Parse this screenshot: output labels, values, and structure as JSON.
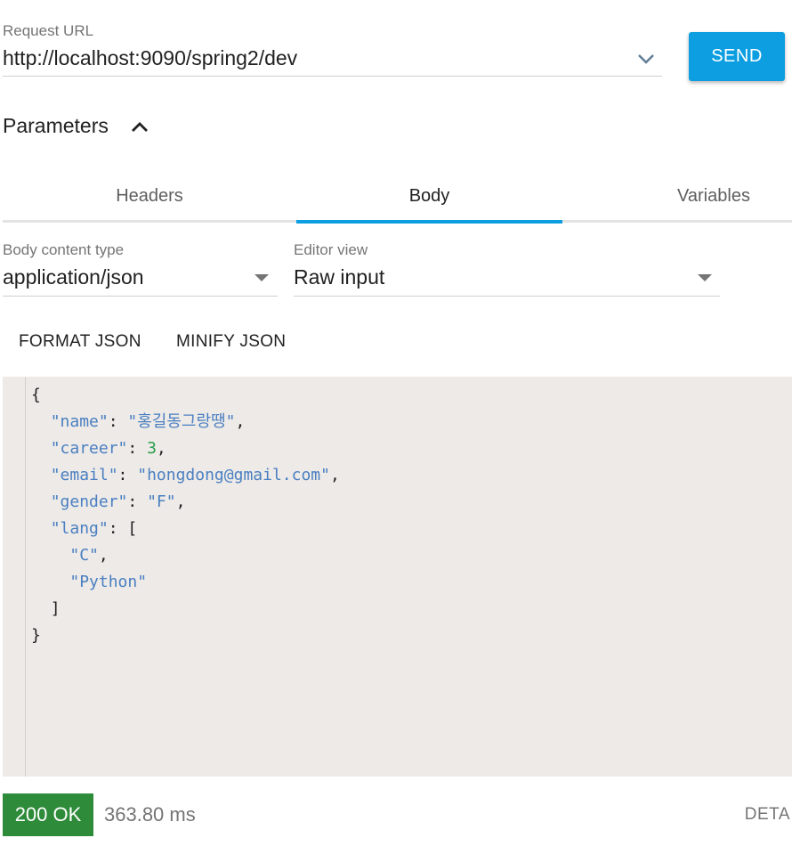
{
  "request": {
    "url_label": "Request URL",
    "url_value": "http://localhost:9090/spring2/dev",
    "send_label": "SEND"
  },
  "parameters": {
    "title": "Parameters",
    "tabs": [
      {
        "label": "Headers"
      },
      {
        "label": "Body",
        "active": true
      },
      {
        "label": "Variables"
      }
    ]
  },
  "body": {
    "content_type_label": "Body content type",
    "content_type_value": "application/json",
    "editor_view_label": "Editor view",
    "editor_view_value": "Raw input",
    "format_label": "FORMAT JSON",
    "minify_label": "MINIFY JSON",
    "code": {
      "open_brace": "{",
      "name_key": "\"name\"",
      "name_val": "\"홍길동그랑땡\"",
      "career_key": "\"career\"",
      "career_val": "3",
      "email_key": "\"email\"",
      "email_val": "\"hongdong@gmail.com\"",
      "gender_key": "\"gender\"",
      "gender_val": "\"F\"",
      "lang_key": "\"lang\"",
      "lang_open": "[",
      "lang_item1": "\"C\"",
      "lang_item2": "\"Python\"",
      "lang_close": "]",
      "close_brace": "}"
    }
  },
  "response": {
    "status": "200 OK",
    "time": "363.80 ms",
    "details_label": "DETA"
  },
  "colors": {
    "accent": "#0c9ee0",
    "status_ok": "#2e8b3a",
    "editor_bg": "#edeae7",
    "json_string": "#4a7fc1",
    "json_number": "#2a9d4a"
  },
  "icons": {
    "url_dropdown": "chevron-down-icon",
    "parameters_toggle": "chevron-up-icon",
    "select_dropdown": "caret-down-icon"
  }
}
